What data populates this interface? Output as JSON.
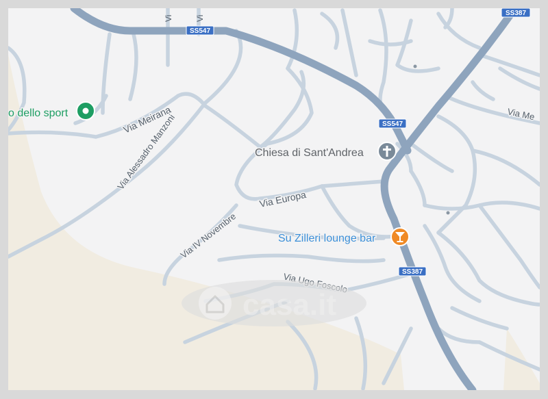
{
  "map": {
    "colors": {
      "background": "#f3f3f4",
      "terrain": "#f1ece1",
      "minor_road": "#c7d3df",
      "main_road": "#8ea4bd",
      "road_label": "#55606b",
      "poi_label": "#5f6368",
      "sport_green": "#1e9e63",
      "bar_orange": "#f08a25",
      "bar_label": "#3b8fd8",
      "shield_blue": "#3a6fc4"
    },
    "road_labels": {
      "via_meirana": "Via Meirana",
      "via_manzoni": "Via Alessadro Manzoni",
      "via_europa": "Via Europa",
      "via_iv_novembre": "Via IV Novembre",
      "via_ugo_foscolo": "Via Ugo Foscolo",
      "via_me_partial": "Via Me",
      "via_vi_1": "Vi",
      "via_vi_2": "Vi"
    },
    "shields": {
      "ss547_top": "SS547",
      "ss547_mid": "SS547",
      "ss387_top": "SS387",
      "ss387_mid": "SS387"
    },
    "pois": {
      "sport": {
        "label": "o dello sport",
        "icon": "park-marker-icon"
      },
      "church": {
        "label": "Chiesa di Sant'Andrea",
        "icon": "church-cross-icon"
      },
      "bar": {
        "label": "Su Zilleri lounge bar",
        "icon": "cocktail-icon"
      }
    },
    "watermark": {
      "text": "casa.it",
      "icon": "house-icon"
    }
  }
}
